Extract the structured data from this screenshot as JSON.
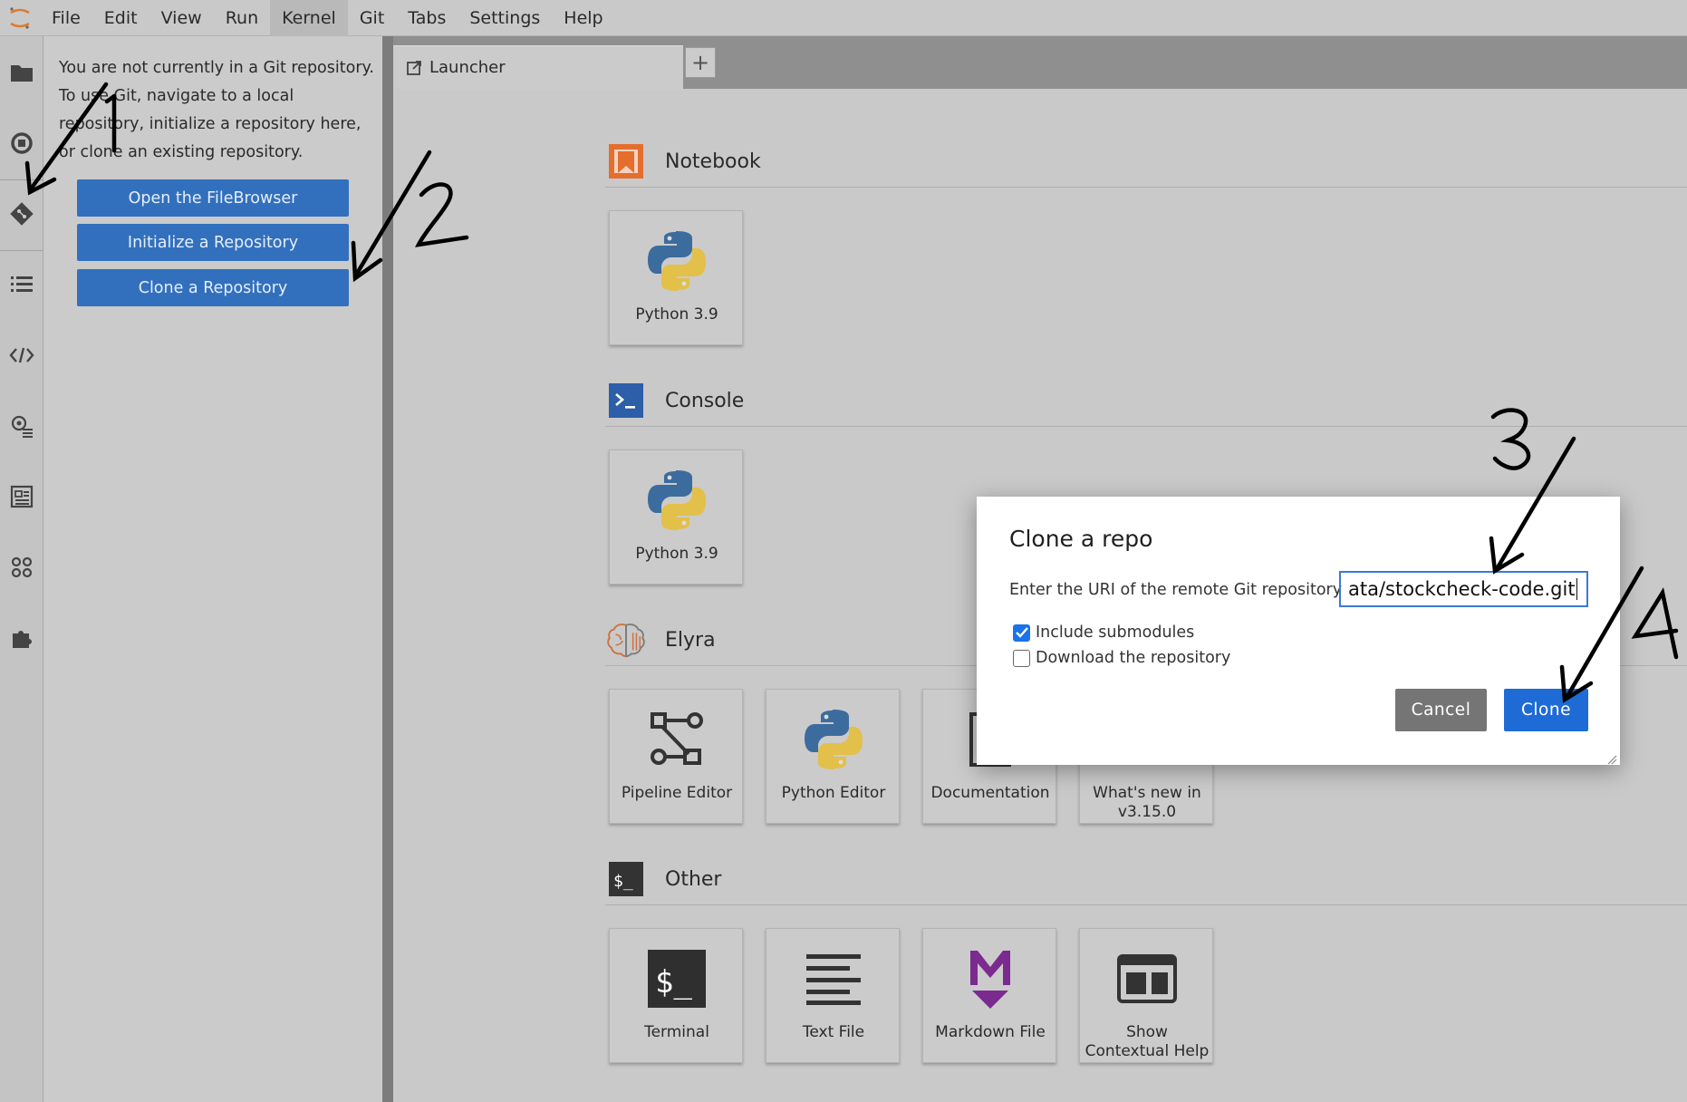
{
  "menubar": {
    "items": [
      "File",
      "Edit",
      "View",
      "Run",
      "Kernel",
      "Git",
      "Tabs",
      "Settings",
      "Help"
    ],
    "active": "Kernel"
  },
  "rail": {
    "icons": [
      "folder-icon",
      "running-icon",
      "git-icon",
      "toc-icon",
      "code-snippets-icon",
      "property-inspector-icon",
      "runtime-images-icon",
      "extensions-tree-icon",
      "extension-manager-icon"
    ]
  },
  "git_panel": {
    "message": "You are not currently in a Git repository. To use Git, navigate to a local repository, initialize a repository here, or clone an existing repository.",
    "buttons": {
      "open_filebrowser": "Open the FileBrowser",
      "initialize": "Initialize a Repository",
      "clone": "Clone a Repository"
    }
  },
  "tabs": {
    "launcher": "Launcher",
    "add": "+"
  },
  "launcher": {
    "sections": {
      "notebook": "Notebook",
      "console": "Console",
      "elyra": "Elyra",
      "other": "Other"
    },
    "cards": {
      "notebook_python": "Python 3.9",
      "console_python": "Python 3.9",
      "pipeline_editor": "Pipeline Editor",
      "python_editor": "Python Editor",
      "documentation": "Documentation",
      "whats_new_1": "What's new in",
      "whats_new_2": "v3.15.0",
      "terminal": "Terminal",
      "text_file": "Text File",
      "markdown_file": "Markdown File",
      "contextual_help_1": "Show",
      "contextual_help_2": "Contextual Help"
    }
  },
  "dialog": {
    "title": "Clone a repo",
    "uri_label": "Enter the URI of the remote Git repository",
    "uri_value": "ata/stockcheck-code.git",
    "include_submodules": "Include submodules",
    "include_submodules_checked": true,
    "download_repository": "Download the repository",
    "download_repository_checked": false,
    "cancel": "Cancel",
    "clone": "Clone"
  },
  "annotations": {
    "step1": "1",
    "step2": "2",
    "step3": "3",
    "step4": "4"
  },
  "colors": {
    "accent_blue": "#3270bd",
    "clone_blue": "#1f6bd6",
    "notebook_orange": "#e46e2e",
    "console_blue": "#2d5ea8",
    "markdown_purple": "#7b2a8f"
  }
}
